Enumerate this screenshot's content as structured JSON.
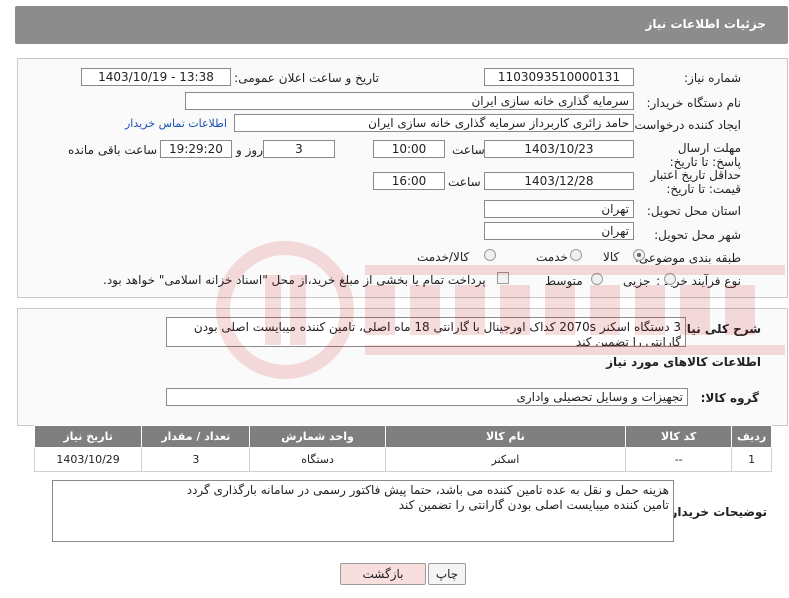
{
  "header": {
    "title": "جزئیات اطلاعات نیاز"
  },
  "form": {
    "need_number_label": "شماره نیاز:",
    "need_number": "1103093510000131",
    "announce_label": "تاریخ و ساعت اعلان عمومی:",
    "announce_value": "1403/10/19 - 13:38",
    "buyer_org_label": "نام دستگاه خریدار:",
    "buyer_org": "سرمایه گذاری خانه سازی ایران",
    "creator_label": "ایجاد کننده درخواست:",
    "creator": "حامد زائری کاربرداز سرمایه گذاری خانه سازی ایران",
    "contact_link": "اطلاعات تماس خریدار",
    "deadline_label": "مهلت ارسال پاسخ: تا تاریخ:",
    "deadline_date": "1403/10/23",
    "time_label": "ساعت",
    "deadline_time": "10:00",
    "days_value": "3",
    "days_label": "روز و",
    "remaining_time": "19:29:20",
    "remaining_label": "ساعت باقی مانده",
    "validity_label": "حداقل تاریخ اعتبار قیمت: تا تاریخ:",
    "validity_date": "1403/12/28",
    "validity_time_label": "ساعت",
    "validity_time": "16:00",
    "province_label": "استان محل تحویل:",
    "province": "تهران",
    "city_label": "شهر محل تحویل:",
    "city": "تهران",
    "category_label": "طبقه بندی موضوعی:",
    "category_options": [
      "کالا",
      "خدمت",
      "کالا/خدمت"
    ],
    "purchase_type_label": "نوع فرآیند خرید :",
    "purchase_options": [
      "جزیی",
      "متوسط"
    ],
    "payment_note": "پرداخت تمام یا بخشی از مبلغ خرید،از محل \"اسناد خزانه اسلامی\" خواهد بود."
  },
  "description": {
    "label": "شرح کلی نیاز:",
    "text": "3 دستگاه اسکنر 2070s کداک اورجینال با گارانتی 18 ماه اصلی، تامین کننده میبایست اصلی بودن گارانتی را تضمین کند"
  },
  "goods": {
    "section_title": "اطلاعات کالاهای مورد نیاز",
    "group_label": "گروه کالا:",
    "group_value": "تجهیزات و وسایل تحصیلی واداری",
    "columns": [
      "ردیف",
      "کد کالا",
      "نام کالا",
      "واحد شمارش",
      "تعداد / مقدار",
      "تاریخ نیاز"
    ],
    "rows": [
      [
        "1",
        "--",
        "اسکنر",
        "دستگاه",
        "3",
        "1403/10/29"
      ]
    ]
  },
  "buyer_notes": {
    "label": "توضیحات خریدار:",
    "line1": "هزینه حمل و نقل به عده تامین کننده می باشد، حتما پیش فاکتور رسمی در سامانه بارگذاری گردد",
    "line2": "تامین کننده میبایست اصلی بودن گارانتی را تضمین کند"
  },
  "buttons": {
    "print": "چاپ",
    "back": "بازگشت"
  },
  "colors": {
    "header_bg": "#8c8c8c",
    "link": "#1a4fb5",
    "back_btn": "#f9dede"
  }
}
